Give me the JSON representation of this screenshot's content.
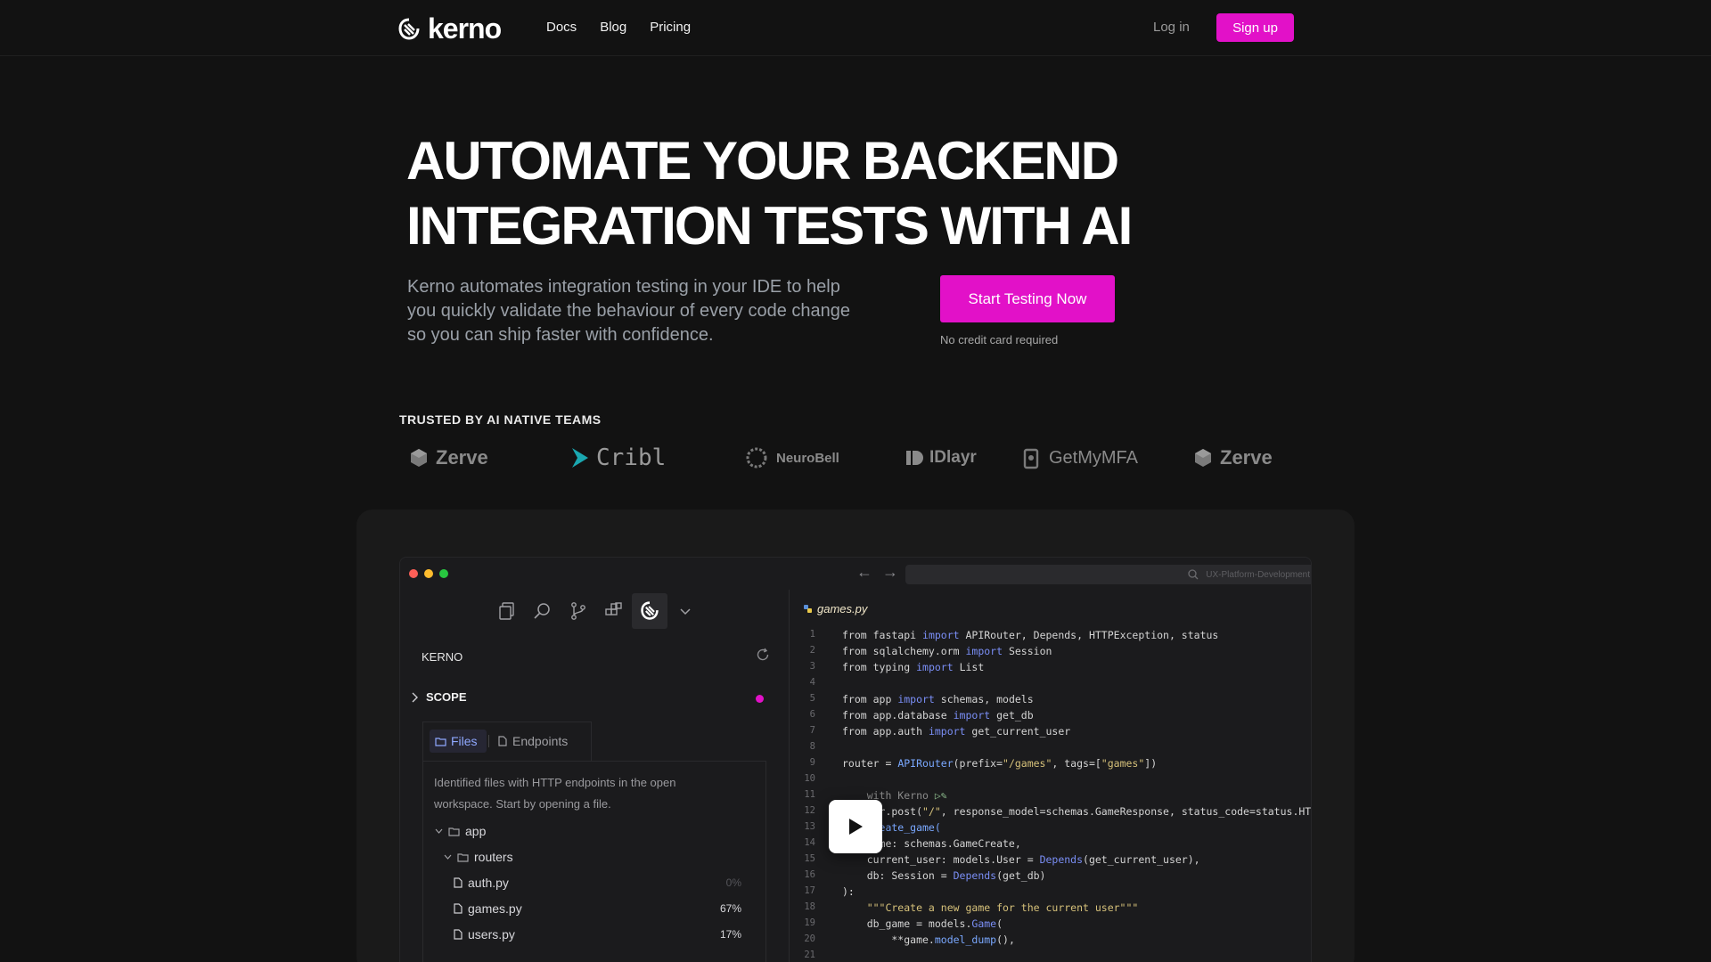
{
  "nav": {
    "logo_text": "kerno",
    "links": [
      "Docs",
      "Blog",
      "Pricing"
    ],
    "login": "Log in",
    "signup": "Sign up"
  },
  "hero": {
    "title_line1": "AUTOMATE YOUR BACKEND",
    "title_line2": "INTEGRATION TESTS WITH AI",
    "subtitle": "Kerno automates integration testing in your IDE to help you quickly validate the behaviour of every code change so you can ship faster with confidence.",
    "cta": "Start Testing Now",
    "cta_note": "No credit card required"
  },
  "trusted": {
    "heading": "TRUSTED BY AI NATIVE TEAMS",
    "brands": [
      "Zerve",
      "Cribl",
      "NeuroBell",
      "IDlayr",
      "GetMyMFA",
      "Zerve"
    ]
  },
  "ide": {
    "address": "UX-Platform-Development",
    "panel_title": "KERNO",
    "scope_label": "SCOPE",
    "tab_files": "Files",
    "tab_endpoints": "Endpoints",
    "files_desc": "Identified files with HTTP endpoints in the open workspace. Start by opening a file.",
    "tree": {
      "app": "app",
      "routers": "routers",
      "files": [
        {
          "name": "auth.py",
          "pct": "0%"
        },
        {
          "name": "games.py",
          "pct": "67%"
        },
        {
          "name": "users.py",
          "pct": "17%"
        }
      ]
    },
    "file_tab": "games.py",
    "line_numbers": [
      "1",
      "2",
      "3",
      "4",
      "5",
      "6",
      "7",
      "8",
      "9",
      "10",
      "11",
      "12",
      "13",
      "14",
      "15",
      "16",
      "17",
      "18",
      "19",
      "20",
      "21"
    ],
    "code": {
      "l1a": "from fastapi ",
      "l1b": "import",
      "l1c": " APIRouter, Depends, HTTPException, status",
      "l2a": "from sqlalchemy.orm ",
      "l2b": "import",
      "l2c": " Session",
      "l3a": "from typing ",
      "l3b": "import",
      "l3c": " List",
      "l5a": "from app ",
      "l5b": "import",
      "l5c": " schemas, models",
      "l6a": "from app.database ",
      "l6b": "import",
      "l6c": " get_db",
      "l7a": "from app.auth ",
      "l7b": "import",
      "l7c": " get_current_user",
      "l9a": "router = ",
      "l9b": "APIRouter",
      "l9c": "(prefix=",
      "l9d": "\"/games\"",
      "l9e": ", tags=[",
      "l9f": "\"games\"",
      "l9g": "])",
      "l11": "    with Kerno ",
      "l12a": "    ter.post(",
      "l12b": "\"/\"",
      "l12c": ", response_model=schemas.GameResponse, status_code=status.HTTP",
      "l13": "    create_game(",
      "l14": "    game: schemas.GameCreate,",
      "l15a": "    current_user: models.User = ",
      "l15b": "Depends",
      "l15c": "(get_current_user),",
      "l16a": "    db: Session = ",
      "l16b": "Depends",
      "l16c": "(get_db)",
      "l17": "):",
      "l18": "    \"\"\"Create a new game for the current user\"\"\"",
      "l19a": "    db_game = models.",
      "l19b": "Game",
      "l19c": "(",
      "l20a": "        **game.",
      "l20b": "model_dump",
      "l20c": "(),"
    }
  },
  "colors": {
    "accent": "#e211c8",
    "background": "#121212"
  }
}
